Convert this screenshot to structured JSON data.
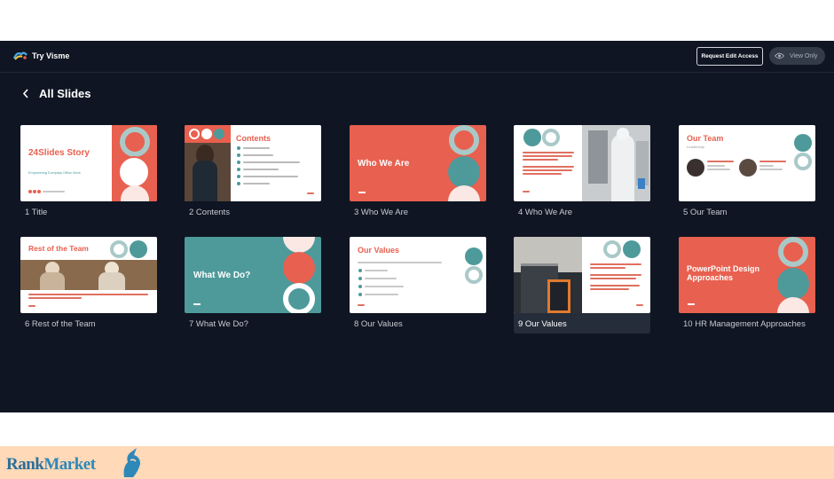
{
  "app": {
    "brand": "Try Visme",
    "request_button": "Request Edit Access",
    "view_only_label": "View Only"
  },
  "header": {
    "back_icon": "chevron-left-icon",
    "title": "All Slides"
  },
  "slides": [
    {
      "label": "1 Title",
      "title": "24Slides Story",
      "subtitle": "Empowering Everyday Office Work"
    },
    {
      "label": "2 Contents",
      "title": "Contents"
    },
    {
      "label": "3 Who We Are",
      "title": "Who We Are"
    },
    {
      "label": "4 Who We Are"
    },
    {
      "label": "5 Our Team",
      "title": "Our Team",
      "subtitle": "Leadership"
    },
    {
      "label": "6 Rest of the Team",
      "title": "Rest of the Team"
    },
    {
      "label": "7 What We Do?",
      "title": "What We Do?"
    },
    {
      "label": "8 Our Values",
      "title": "Our Values"
    },
    {
      "label": "9 Our Values",
      "selected": true
    },
    {
      "label": "10 HR Management Approaches",
      "title": "PowerPoint Design Approaches"
    }
  ],
  "footer": {
    "logo_part1": "Rank",
    "logo_part2": "Market"
  },
  "colors": {
    "background": "#0f1522",
    "coral": "#e8604f",
    "teal": "#4e9a9b",
    "footer": "#ffd9b8"
  }
}
